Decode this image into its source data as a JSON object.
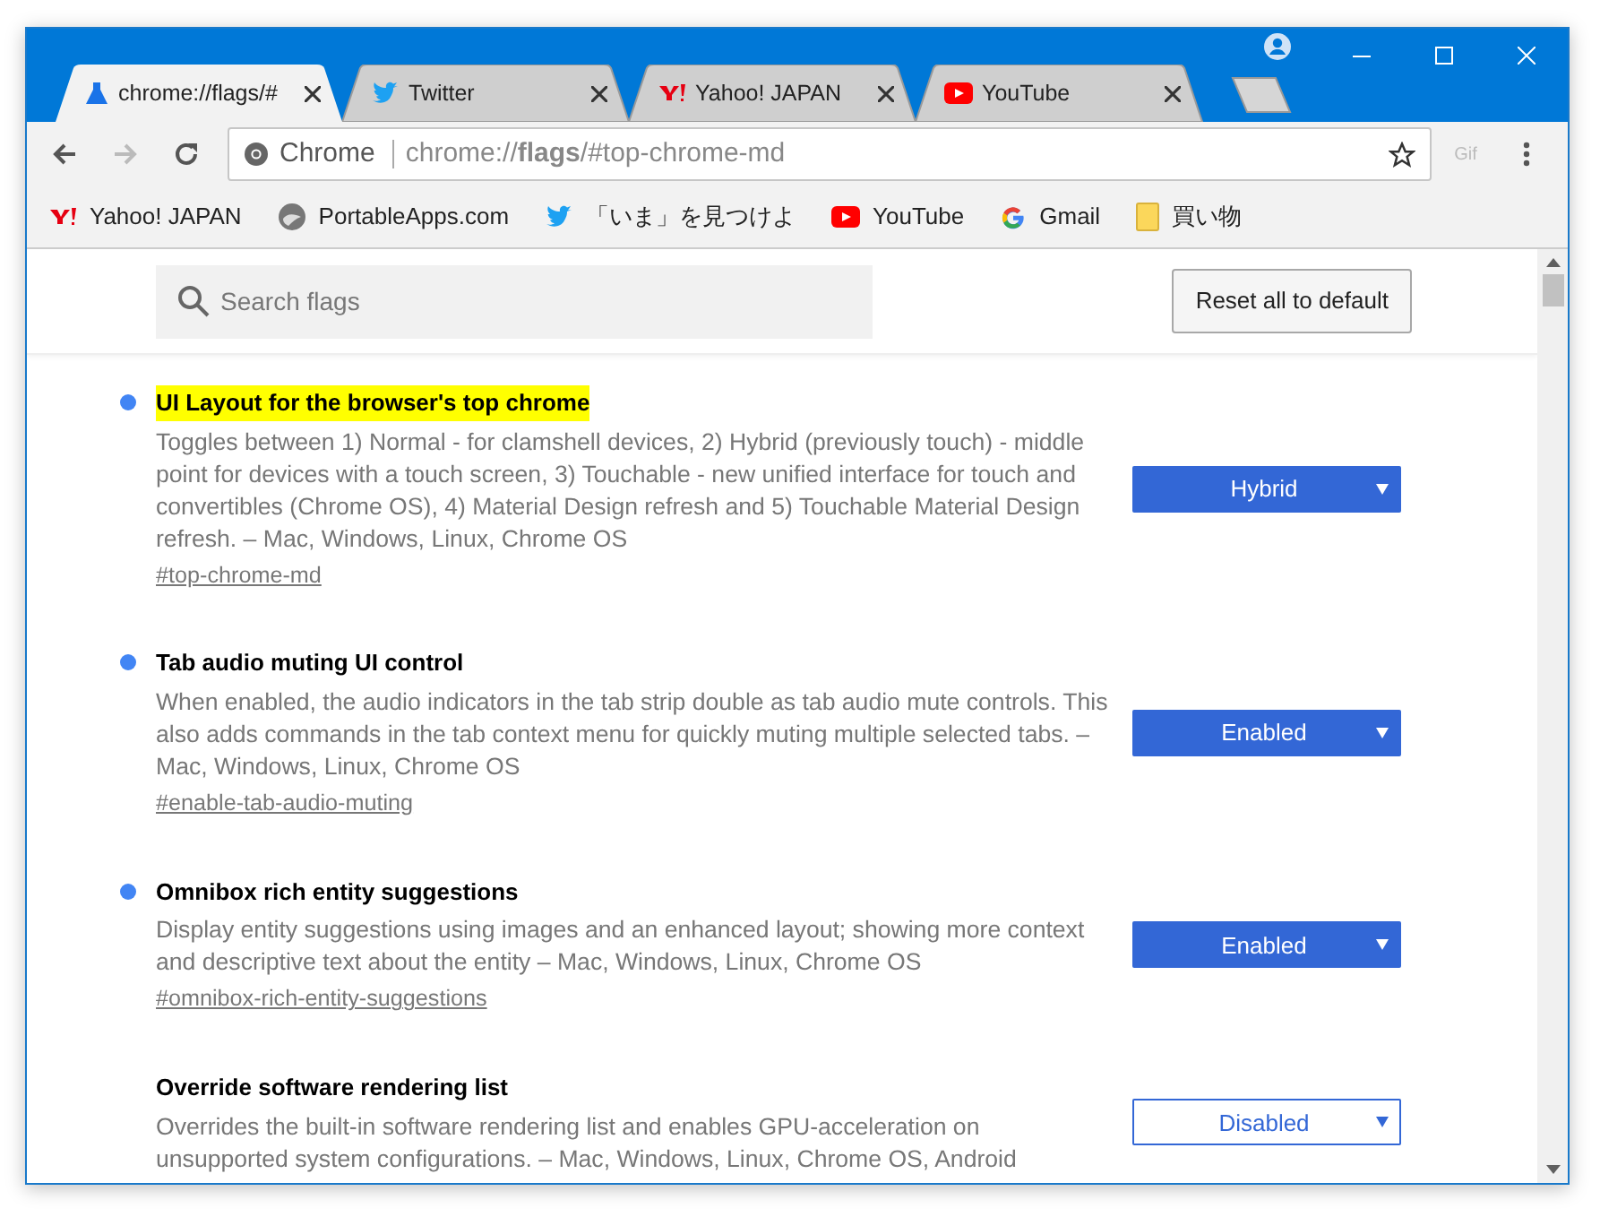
{
  "tabs": [
    {
      "title": "chrome://flags/#",
      "kind": "flask",
      "selected": true
    },
    {
      "title": "Twitter",
      "kind": "twitter",
      "selected": false
    },
    {
      "title": "Yahoo! JAPAN",
      "kind": "yahoo",
      "selected": false
    },
    {
      "title": "YouTube",
      "kind": "youtube",
      "selected": false
    }
  ],
  "omnibox": {
    "chip": "Chrome",
    "url": "chrome://**flags**/#top-chrome-md"
  },
  "extension": "Gif",
  "bookmarks": [
    {
      "label": "Yahoo! JAPAN",
      "kind": "yahoo"
    },
    {
      "label": "PortableApps.com",
      "kind": "portable"
    },
    {
      "label": "「いま」を見つけよ",
      "kind": "twitter"
    },
    {
      "label": "YouTube",
      "kind": "youtube"
    },
    {
      "label": "Gmail",
      "kind": "google"
    },
    {
      "label": "買い物",
      "kind": "folder"
    }
  ],
  "search": {
    "placeholder": "Search flags"
  },
  "reset_button": "Reset all to default",
  "flags": [
    {
      "title": "UI Layout for the browser's top chrome",
      "highlighted": true,
      "modified": true,
      "description": "Toggles between 1) Normal - for clamshell devices, 2) Hybrid (previously touch) - middle point for devices with a touch screen, 3) Touchable - new unified interface for touch and convertibles (Chrome OS), 4) Material Design refresh and 5) Touchable Material Design refresh. – Mac, Windows, Linux, Chrome OS",
      "link": "#top-chrome-md",
      "value": "Hybrid"
    },
    {
      "title": "Tab audio muting UI control",
      "highlighted": false,
      "modified": true,
      "description": "When enabled, the audio indicators in the tab strip double as tab audio mute controls. This also adds commands in the tab context menu for quickly muting multiple selected tabs. – Mac, Windows, Linux, Chrome OS",
      "link": "#enable-tab-audio-muting",
      "value": "Enabled"
    },
    {
      "title": "Omnibox rich entity suggestions",
      "highlighted": false,
      "modified": true,
      "description": "Display entity suggestions using images and an enhanced layout; showing more context and descriptive text about the entity – Mac, Windows, Linux, Chrome OS",
      "link": "#omnibox-rich-entity-suggestions",
      "value": "Enabled"
    },
    {
      "title": "Override software rendering list",
      "highlighted": false,
      "modified": false,
      "description": "Overrides the built-in software rendering list and enables GPU-acceleration on unsupported system configurations. – Mac, Windows, Linux, Chrome OS, Android",
      "value": "Disabled"
    }
  ]
}
